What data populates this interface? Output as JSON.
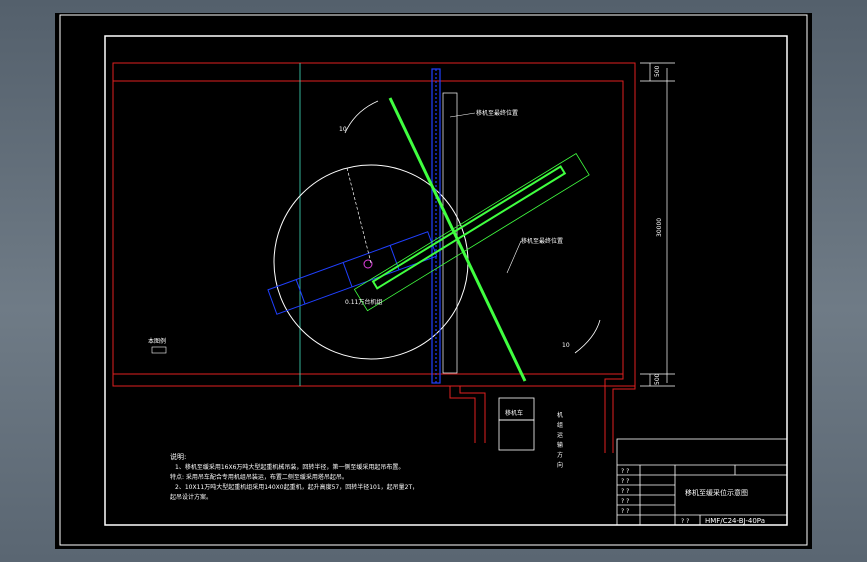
{
  "drawing": {
    "label_top_position": "移机至最终位置",
    "label_mid_position": "移机至最终位置",
    "label_mid_position_b": "移机至最终位置",
    "label_circle": "0.11万台机组",
    "label_left_note": "本图例",
    "label_bottom_box": "移机车",
    "label_arrow_right": "10",
    "label_arrow_left": "10",
    "label_dim_vertical": "30000",
    "label_dim_top": "500",
    "label_dim_bottom": "500",
    "vertical_text": [
      "机",
      "组",
      "运",
      "输",
      "方",
      "向"
    ]
  },
  "notes": {
    "heading": "说明:",
    "line1": "1、移机至缓采用16X6万吨大型起重机械吊装，回转半径，第一侧至缓采用起吊布置。",
    "line2": "特点: 采用吊车配合专用机组吊装运，布置二侧至缓采用塔吊起吊。",
    "line3": "2、10X11万吨大型起重机组采用140X0起重机，起升高度57，回转半径101，起吊量2T，",
    "line4": "起吊设计方案。"
  },
  "title_block": {
    "title": "移机至缓采位示意图",
    "drawing_no": "HMF/C24-BJ-40Pa",
    "cells": [
      "? ?",
      "? ?",
      "? ?",
      "? ?",
      "? ?",
      "? ?"
    ]
  },
  "colors": {
    "frame": "#ffffff",
    "wall": "#e02020",
    "crane_blue": "#2040ff",
    "beam_green": "#40ff40",
    "aux": "#40e0c0"
  }
}
